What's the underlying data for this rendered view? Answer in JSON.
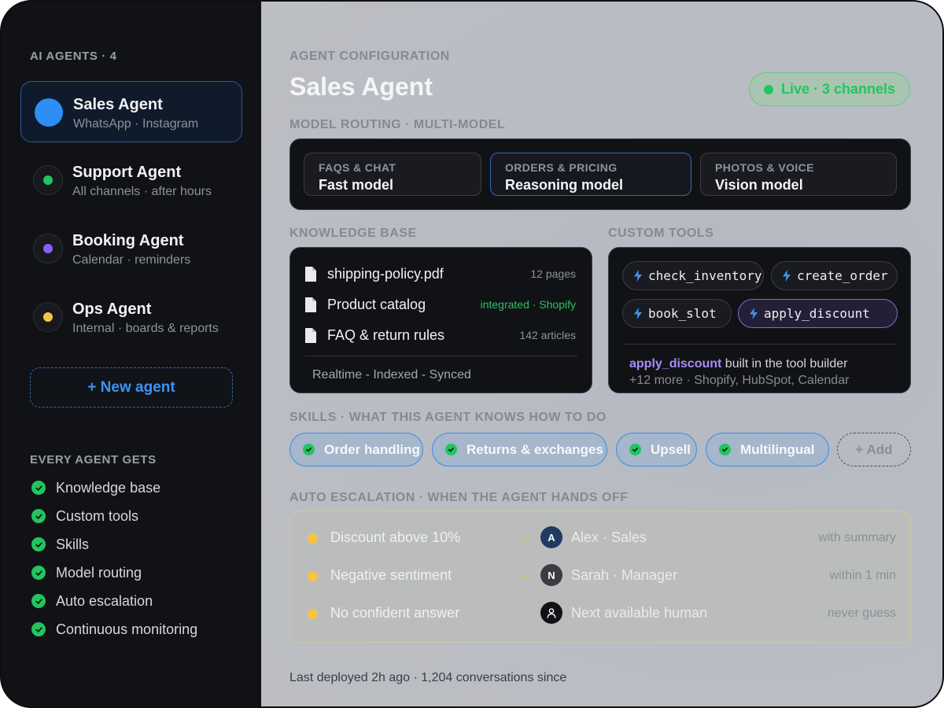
{
  "sidebar": {
    "header": "AI AGENTS · 4",
    "agents": [
      {
        "name": "Sales Agent",
        "channels": "WhatsApp · Instagram",
        "color": "#2d8ff5"
      },
      {
        "name": "Support Agent",
        "channels": "All channels · after hours",
        "color": "#22c55e"
      },
      {
        "name": "Booking Agent",
        "channels": "Calendar · reminders",
        "color": "#8b5cf6"
      },
      {
        "name": "Ops Agent",
        "channels": "Internal · boards & reports",
        "color": "#f5c542"
      }
    ],
    "new_agent_label": "+ New agent",
    "features_header": "EVERY AGENT GETS",
    "features": [
      "Knowledge base",
      "Custom tools",
      "Skills",
      "Model routing",
      "Auto escalation",
      "Continuous monitoring"
    ]
  },
  "main": {
    "section_label": "AGENT CONFIGURATION",
    "title": "Sales Agent",
    "live_badge": "Live · 3 channels",
    "routing": {
      "label": "MODEL ROUTING · MULTI-MODEL",
      "cards": [
        {
          "caption": "FAQS & CHAT",
          "model": "Fast model"
        },
        {
          "caption": "ORDERS & PRICING",
          "model": "Reasoning model",
          "selected": true
        },
        {
          "caption": "PHOTOS & VOICE",
          "model": "Vision model"
        }
      ]
    },
    "knowledge": {
      "label": "KNOWLEDGE BASE",
      "items": [
        {
          "name": "shipping-policy.pdf",
          "meta": "12 pages"
        },
        {
          "name": "Product catalog",
          "meta": "integrated · Shopify"
        },
        {
          "name": "FAQ & return rules",
          "meta": "142 articles"
        }
      ],
      "status": "Realtime - Indexed - Synced"
    },
    "tools": {
      "label": "CUSTOM TOOLS",
      "items": [
        "check_inventory",
        "create_order",
        "book_slot",
        "apply_discount"
      ],
      "note_tool": "apply_discount",
      "note_text": " built in the tool builder",
      "more": "+12 more · Shopify, HubSpot, Calendar"
    },
    "skills": {
      "label": "SKILLS · WHAT THIS AGENT KNOWS HOW TO DO",
      "items": [
        "Order handling",
        "Returns & exchanges",
        "Upsell",
        "Multilingual"
      ],
      "add_label": "+ Add"
    },
    "escalation": {
      "label": "AUTO ESCALATION · WHEN THE AGENT HANDS OFF",
      "rules": [
        {
          "condition": "Discount above 10%",
          "arrow": "→",
          "initial": "A",
          "person": "Alex · Sales",
          "note": "with summary"
        },
        {
          "condition": "Negative sentiment",
          "arrow": "→",
          "initial": "N",
          "person": "Sarah · Manager",
          "note": "within 1 min"
        },
        {
          "condition": "No confident answer",
          "arrow": "→",
          "initial": "",
          "person": "Next available human",
          "note": "never guess"
        }
      ]
    },
    "footer": "Last deployed 2h ago · 1,204 conversations since"
  }
}
